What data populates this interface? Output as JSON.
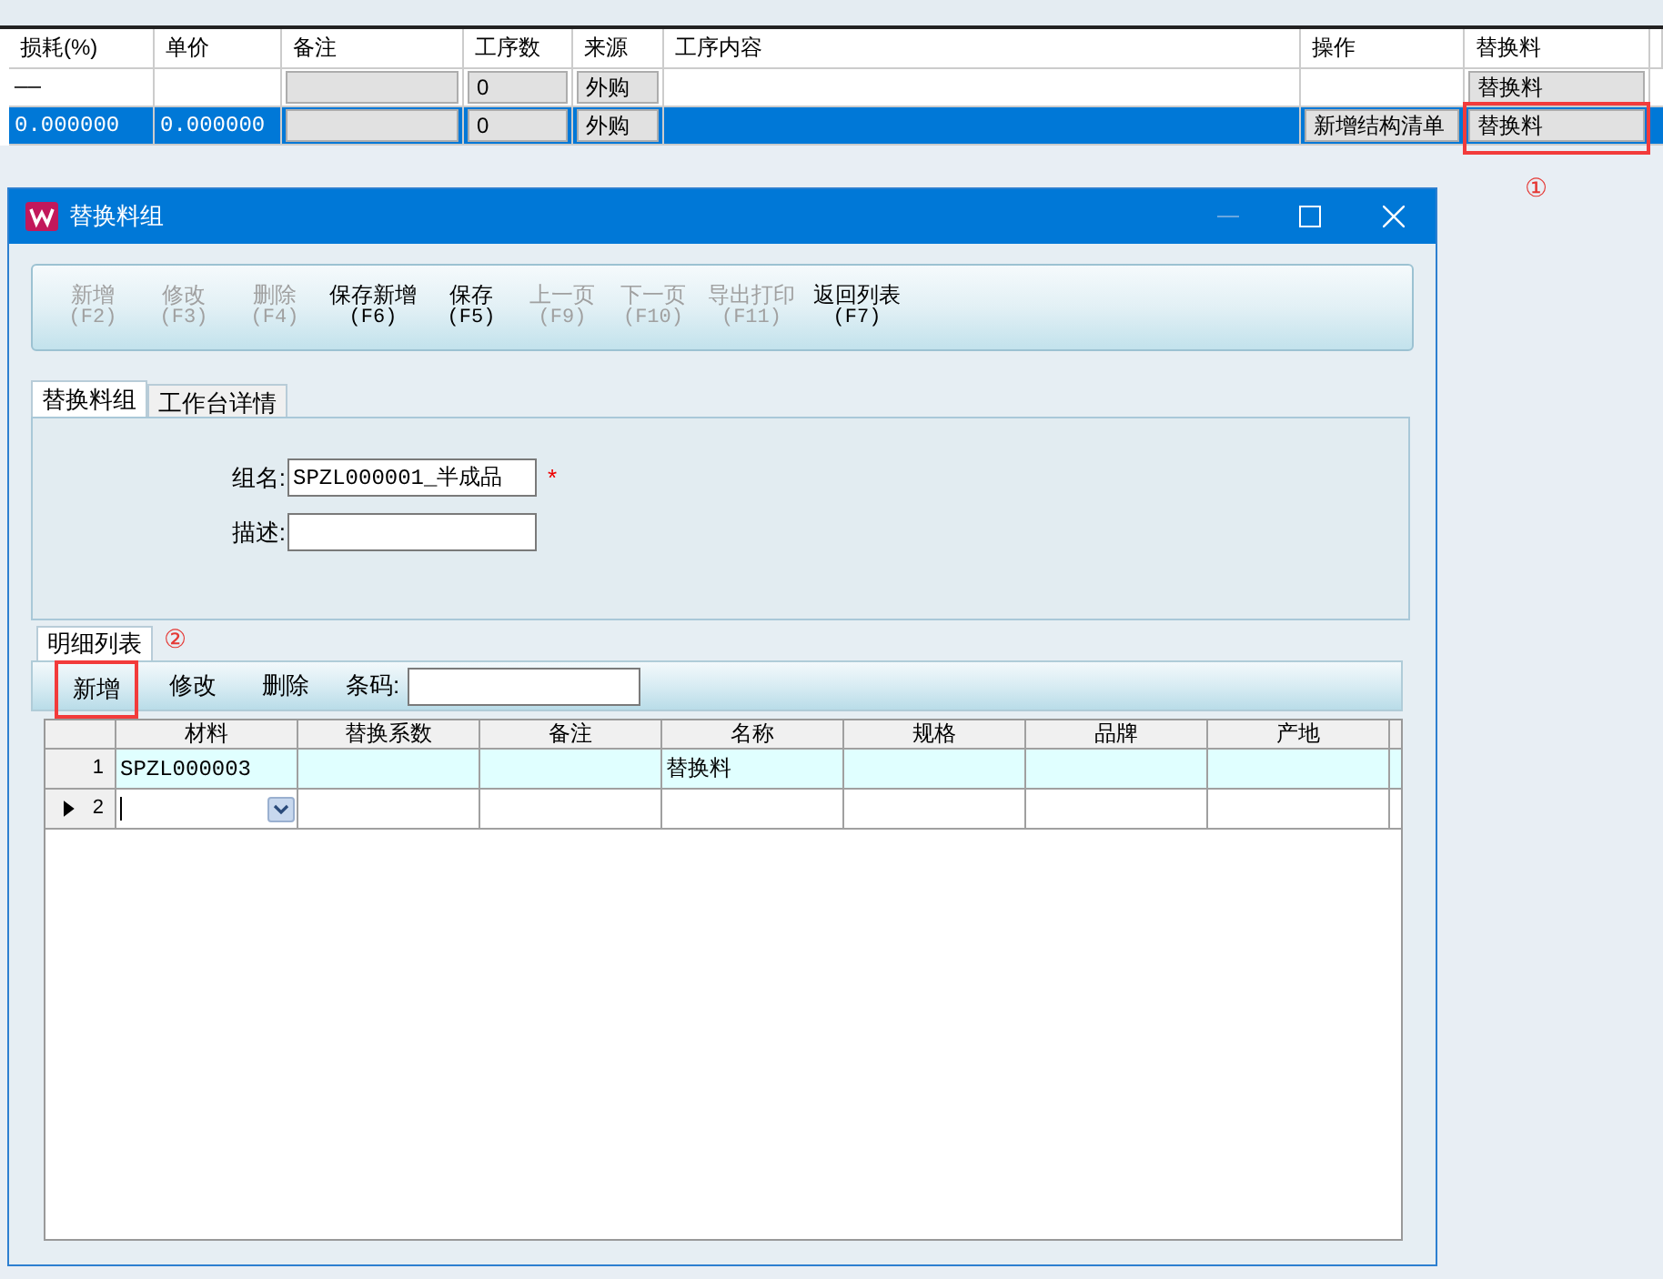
{
  "main_grid": {
    "columns": [
      "损耗(%)",
      "单价",
      "备注",
      "工序数",
      "来源",
      "工序内容",
      "操作",
      "替换料"
    ],
    "rows": [
      {
        "selected": false,
        "cells": [
          {
            "kind": "text",
            "text": "——"
          },
          {
            "kind": "text"
          },
          {
            "kind": "button"
          },
          {
            "kind": "button",
            "text": "0"
          },
          {
            "kind": "button",
            "text": "外购"
          },
          {
            "kind": "text"
          },
          {
            "kind": "text"
          },
          {
            "kind": "button",
            "text": "替换料",
            "highlighted": false
          }
        ]
      },
      {
        "selected": true,
        "cells": [
          {
            "kind": "text",
            "text": "0.000000"
          },
          {
            "kind": "text",
            "text": "0.000000"
          },
          {
            "kind": "button"
          },
          {
            "kind": "button",
            "text": "0"
          },
          {
            "kind": "button",
            "text": "外购"
          },
          {
            "kind": "text"
          },
          {
            "kind": "button",
            "text": "新增结构清单"
          },
          {
            "kind": "button",
            "text": "替换料",
            "highlighted": true
          }
        ]
      }
    ],
    "callout": "①"
  },
  "dialog": {
    "title": "替换料组",
    "toolbar": [
      {
        "label": "新增",
        "key": "(F2)",
        "disabled": true
      },
      {
        "label": "修改",
        "key": "(F3)",
        "disabled": true
      },
      {
        "label": "删除",
        "key": "(F4)",
        "disabled": true
      },
      {
        "label": "保存新增",
        "key": "(F6)",
        "disabled": false
      },
      {
        "label": "保存",
        "key": "(F5)",
        "disabled": false
      },
      {
        "label": "上一页",
        "key": "(F9)",
        "disabled": true
      },
      {
        "label": "下一页",
        "key": "(F10)",
        "disabled": true
      },
      {
        "label": "导出打印",
        "key": "(F11)",
        "disabled": true
      },
      {
        "label": "返回列表",
        "key": "(F7)",
        "disabled": false
      }
    ],
    "tabs": [
      {
        "label": "替换料组",
        "selected": true
      },
      {
        "label": "工作台详情",
        "selected": false
      }
    ],
    "fields": [
      {
        "label": "组名:",
        "value": "SPZL000001_半成品",
        "required_mark": "*"
      },
      {
        "label": "描述:"
      }
    ],
    "detail": {
      "tab": "明细列表",
      "callout": "②",
      "buttons": [
        {
          "label": "新增",
          "highlighted": true
        },
        {
          "label": "修改",
          "highlighted": false
        },
        {
          "label": "删除",
          "highlighted": false
        }
      ],
      "barcode_label": "条码:",
      "columns": [
        "材料",
        "替换系数",
        "备注",
        "名称",
        "规格",
        "品牌",
        "产地"
      ],
      "rows": [
        {
          "number": "1",
          "current": false,
          "cells": [
            "SPZL000003",
            null,
            null,
            "替换料",
            null,
            null,
            null
          ]
        },
        {
          "number": "2",
          "current": true,
          "editing": true,
          "cells": [
            null,
            null,
            null,
            null,
            null,
            null,
            null
          ]
        }
      ]
    }
  }
}
